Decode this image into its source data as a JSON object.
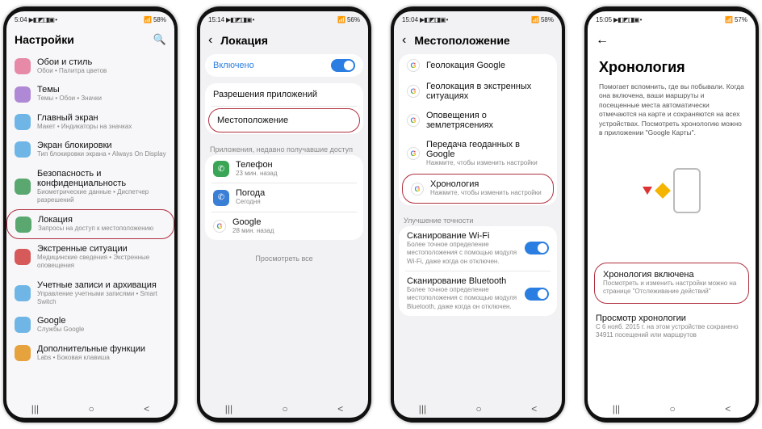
{
  "status": {
    "t1": "5:04",
    "t2": "15:14",
    "t3": "15:04",
    "t4": "15:05",
    "icons": "▶◧◩◨▣ •",
    "sig": "📶",
    "bat1": "58%",
    "bat2": "56%",
    "bat4": "57%"
  },
  "p1": {
    "title": "Настройки",
    "items": [
      {
        "t": "Обои и стиль",
        "s": "Обои • Палитра цветов",
        "c": "#e68aa8"
      },
      {
        "t": "Темы",
        "s": "Темы • Обои • Значки",
        "c": "#b089d6"
      },
      {
        "t": "Главный экран",
        "s": "Макет • Индикаторы на значках",
        "c": "#6fb6e6"
      },
      {
        "t": "Экран блокировки",
        "s": "Тип блокировки экрана • Always On Display",
        "c": "#6fb6e6"
      },
      {
        "t": "Безопасность и конфиденциальность",
        "s": "Биометрические данные • Диспетчер разрешений",
        "c": "#5aa86f"
      },
      {
        "t": "Локация",
        "s": "Запросы на доступ к местоположению",
        "c": "#5aa86f",
        "hl": true
      },
      {
        "t": "Экстренные ситуации",
        "s": "Медицинские сведения • Экстренные оповещения",
        "c": "#d65a5a"
      },
      {
        "t": "Учетные записи и архивация",
        "s": "Управление учетными записями • Smart Switch",
        "c": "#6fb6e6"
      },
      {
        "t": "Google",
        "s": "Службы Google",
        "c": "#6fb6e6"
      },
      {
        "t": "Дополнительные функции",
        "s": "Labs • Боковая клавиша",
        "c": "#e6a23c"
      }
    ]
  },
  "p2": {
    "title": "Локация",
    "on": "Включено",
    "perm": "Разрешения приложений",
    "loc": "Местоположение",
    "recent": "Приложения, недавно получавшие доступ",
    "apps": [
      {
        "n": "Телефон",
        "s": "23 мин. назад",
        "c": "#3aa655"
      },
      {
        "n": "Погода",
        "s": "Сегодня",
        "c": "#3a7fd6"
      },
      {
        "n": "Google",
        "s": "28 мин. назад",
        "c": "#fff",
        "g": true
      }
    ],
    "all": "Просмотреть все"
  },
  "p3": {
    "title": "Местоположение",
    "top": [
      {
        "t": "Геолокация Google",
        "g": true
      },
      {
        "t": "Геолокация в экстренных ситуациях",
        "g": true
      },
      {
        "t": "Оповещения о землетрясениях",
        "g": true
      },
      {
        "t": "Передача геоданных в Google",
        "s": "Нажмите, чтобы изменить настройки",
        "g": true
      },
      {
        "t": "Хронология",
        "s": "Нажмите, чтобы изменить настройки",
        "g": true,
        "hl": true
      }
    ],
    "sec": "Улучшение точности",
    "scan": [
      {
        "t": "Сканирование Wi-Fi",
        "s": "Более точное определение местоположения с помощью модуля Wi-Fi, даже когда он отключен."
      },
      {
        "t": "Сканирование Bluetooth",
        "s": "Более точное определение местоположения с помощью модуля Bluetooth, даже когда он отключен."
      }
    ]
  },
  "p4": {
    "title": "Хронология",
    "para": "Помогает вспомнить, где вы побывали. Когда она включена, ваши маршруты и посещенные места автоматически отмечаются на карте и сохраняются на всех устройствах. Посмотреть хронологию можно в приложении \"Google Карты\".",
    "on_t": "Хронология включена",
    "on_s": "Посмотреть и изменить настройки можно на странице \"Отслеживание действий\"",
    "view_t": "Просмотр хронологии",
    "view_s": "С 6 нояб. 2015 г. на этом устройстве сохранено 34911 посещений или маршрутов"
  },
  "nav": {
    "a": "|||",
    "b": "○",
    "c": "<"
  }
}
